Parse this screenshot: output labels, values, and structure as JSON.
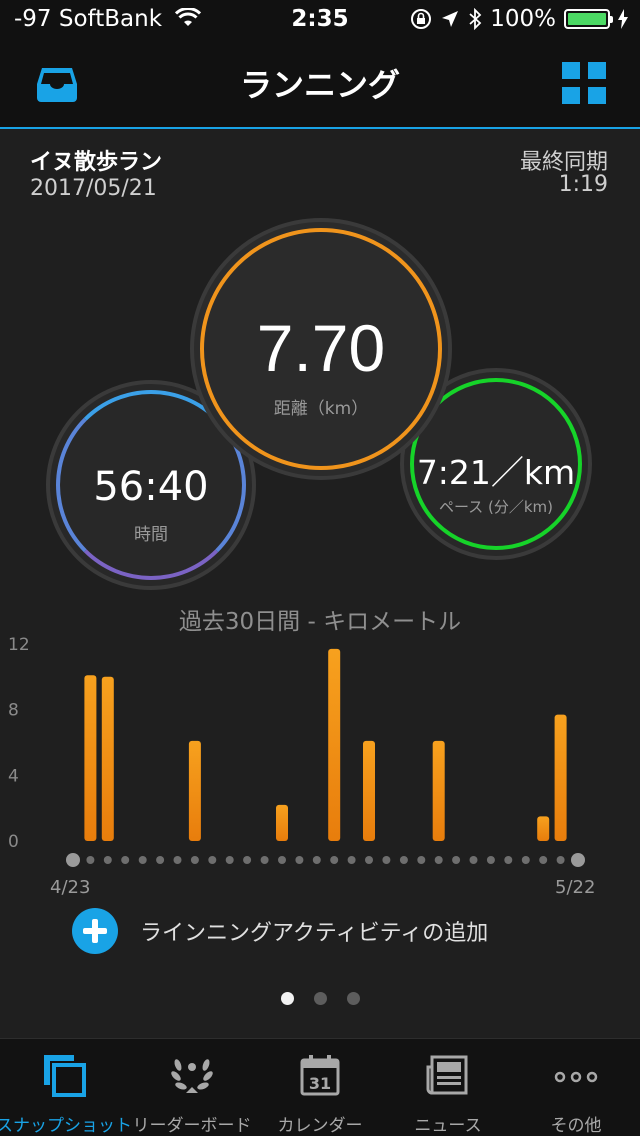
{
  "status_bar": {
    "carrier": "-97 SoftBank",
    "time": "2:35",
    "battery": "100%"
  },
  "nav": {
    "title": "ランニング"
  },
  "activity": {
    "name": "イヌ散歩ラン",
    "date": "2017/05/21",
    "sync_label": "最終同期",
    "sync_time": "1:19"
  },
  "metrics": {
    "distance": {
      "value": "7.70",
      "label": "距離（km）"
    },
    "time": {
      "value": "56:40",
      "label": "時間"
    },
    "pace": {
      "value": "7:21／km",
      "label": "ペース (分／km)"
    }
  },
  "colors": {
    "accent": "#19a3e6",
    "distance_ring": "#f0941c",
    "pace_ring": "#16d329",
    "time_ring": "#5a84d8",
    "bar": "#f0941c"
  },
  "chart_data": {
    "type": "bar",
    "title": "過去30日間 - キロメートル",
    "ylim": [
      0,
      12
    ],
    "yticks": [
      "0",
      "4",
      "8",
      "12"
    ],
    "x_start_label": "4/23",
    "x_end_label": "5/22",
    "days": 30,
    "values": [
      0,
      10.1,
      10.0,
      0,
      0,
      0,
      0,
      6.1,
      0,
      0,
      0,
      0,
      2.2,
      0,
      0,
      11.7,
      0,
      6.1,
      0,
      0,
      0,
      6.1,
      0,
      0,
      0,
      0,
      0,
      1.5,
      7.7,
      0
    ]
  },
  "add_activity": {
    "label": "ラインニングアクティビティの追加"
  },
  "pager": {
    "count": 3,
    "active": 0
  },
  "tabs": [
    {
      "label": "スナップショット",
      "icon": "snapshot-icon",
      "active": true
    },
    {
      "label": "リーダーボード",
      "icon": "laurel-icon",
      "active": false
    },
    {
      "label": "カレンダー",
      "icon": "calendar-icon",
      "calendar_day": "31",
      "active": false
    },
    {
      "label": "ニュース",
      "icon": "news-icon",
      "active": false
    },
    {
      "label": "その他",
      "icon": "more-icon",
      "active": false
    }
  ]
}
